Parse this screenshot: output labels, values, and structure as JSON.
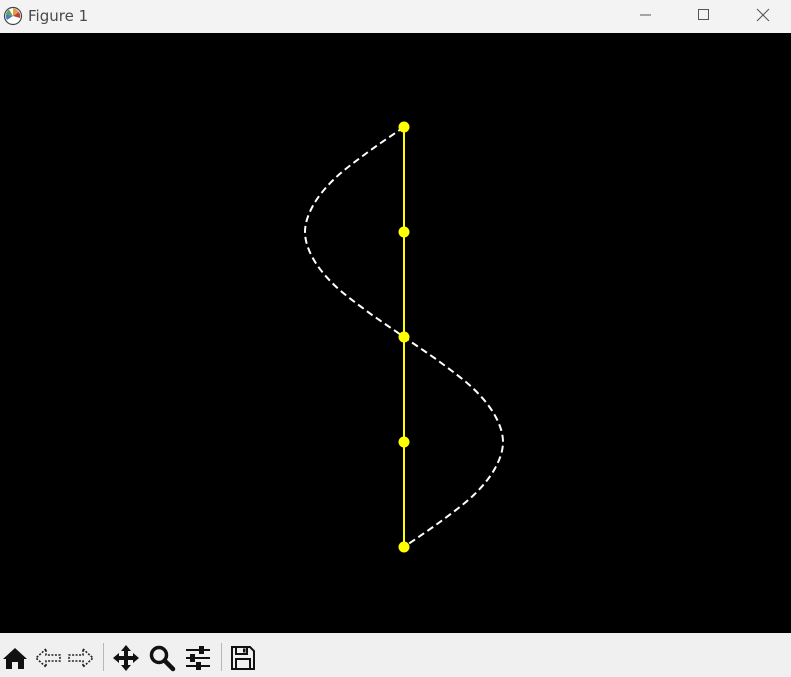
{
  "window": {
    "title": "Figure 1"
  },
  "colors": {
    "background": "#000000",
    "solid_line": "#ffff00",
    "dashed_curve": "#ffffff",
    "markers": "#ffff00"
  },
  "chart_data": {
    "type": "line",
    "title": "",
    "xlabel": "",
    "ylabel": "",
    "axes_visible": false,
    "grid": false,
    "series": [
      {
        "style": "solid",
        "color": "#ffff00",
        "markers": true,
        "x": [
          0,
          0,
          0,
          0,
          0
        ],
        "y": [
          2,
          1,
          0,
          -1,
          -2
        ]
      },
      {
        "style": "dashed",
        "color": "#ffffff",
        "markers": false,
        "x": [
          0,
          -0.38,
          -0.71,
          -0.92,
          -1.0,
          -0.92,
          -0.71,
          -0.38,
          0,
          0.38,
          0.71,
          0.92,
          1.0,
          0.92,
          0.71,
          0.38,
          0
        ],
        "y": [
          2,
          1.75,
          1.5,
          1.25,
          1.0,
          0.75,
          0.5,
          0.25,
          0,
          -0.25,
          -0.5,
          -0.75,
          -1.0,
          -1.25,
          -1.5,
          -1.75,
          -2
        ]
      }
    ]
  },
  "toolbar": {
    "tools": [
      "home-icon",
      "back-icon",
      "forward-icon",
      "pan-icon",
      "zoom-icon",
      "configure-subplots-icon",
      "save-icon"
    ]
  }
}
